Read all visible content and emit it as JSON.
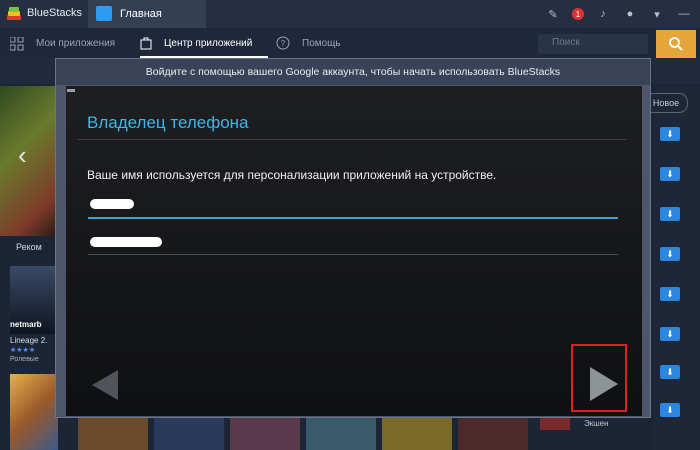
{
  "titlebar": {
    "brand": "BlueStacks",
    "tab_home": "Главная",
    "notification_count": "1"
  },
  "nav": {
    "items": [
      "Мои приложения",
      "Центр приложений",
      "Помощь"
    ],
    "active_index": 1,
    "search_placeholder": "Поиск"
  },
  "background": {
    "rec_label": "Реком",
    "game1_brand": "netmarb",
    "game1_name": "Lineage 2.",
    "game1_category": "Ролевые",
    "game1_stars": "★★★★",
    "new_pill": "Новое",
    "action_category": "Экшен"
  },
  "dialog": {
    "title": "Войдите с помощью вашего Google аккаунта, чтобы начать использовать BlueStacks",
    "heading": "Владелец телефона",
    "description": "Ваше имя используется для персонализации приложений на устройстве."
  },
  "colors": {
    "accent_blue": "#3fb6e6",
    "highlight_red": "#e02020",
    "search_orange": "#e5a53b"
  }
}
